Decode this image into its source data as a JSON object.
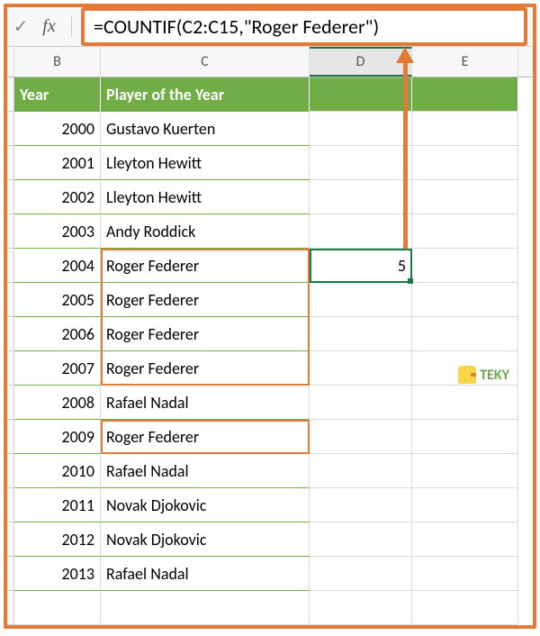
{
  "chart_data": {
    "type": "table",
    "columns": [
      "Year",
      "Player of the Year"
    ],
    "rows": [
      [
        2000,
        "Gustavo Kuerten"
      ],
      [
        2001,
        "Lleyton Hewitt"
      ],
      [
        2002,
        "Lleyton Hewitt"
      ],
      [
        2003,
        "Andy Roddick"
      ],
      [
        2004,
        "Roger Federer"
      ],
      [
        2005,
        "Roger Federer"
      ],
      [
        2006,
        "Roger Federer"
      ],
      [
        2007,
        "Roger Federer"
      ],
      [
        2008,
        "Rafael Nadal"
      ],
      [
        2009,
        "Roger Federer"
      ],
      [
        2010,
        "Rafael Nadal"
      ],
      [
        2011,
        "Novak Djokovic"
      ],
      [
        2012,
        "Novak Djokovic"
      ],
      [
        2013,
        "Rafael Nadal"
      ]
    ],
    "countif_result": 5
  },
  "formula_bar": {
    "fx_label": "fx",
    "formula": "=COUNTIF(C2:C15,\"Roger Federer\")"
  },
  "columns": {
    "b": "B",
    "c": "C",
    "d": "D",
    "e": "E"
  },
  "headers": {
    "year": "Year",
    "player": "Player of the Year"
  },
  "rows": [
    {
      "year": "2000",
      "player": "Gustavo Kuerten"
    },
    {
      "year": "2001",
      "player": "Lleyton Hewitt"
    },
    {
      "year": "2002",
      "player": "Lleyton Hewitt"
    },
    {
      "year": "2003",
      "player": "Andy Roddick"
    },
    {
      "year": "2004",
      "player": "Roger Federer"
    },
    {
      "year": "2005",
      "player": "Roger Federer"
    },
    {
      "year": "2006",
      "player": "Roger Federer"
    },
    {
      "year": "2007",
      "player": "Roger Federer"
    },
    {
      "year": "2008",
      "player": "Rafael Nadal"
    },
    {
      "year": "2009",
      "player": "Roger Federer"
    },
    {
      "year": "2010",
      "player": "Rafael Nadal"
    },
    {
      "year": "2011",
      "player": "Novak Djokovic"
    },
    {
      "year": "2012",
      "player": "Novak Djokovic"
    },
    {
      "year": "2013",
      "player": "Rafael Nadal"
    }
  ],
  "result_cell": {
    "value": "5"
  },
  "logo_text": "TEKY"
}
